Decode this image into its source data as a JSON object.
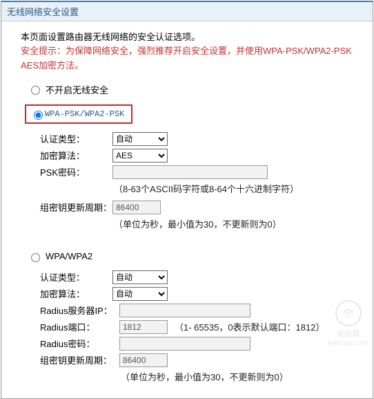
{
  "header": {
    "title": "无线网络安全设置"
  },
  "intro": "本页面设置路由器无线网络的安全认证选项。",
  "warning": "安全提示：为保障网络安全，强烈推荐开启安全设置，并使用WPA-PSK/WPA2-PSK AES加密方法。",
  "options": {
    "disable": {
      "label": "不开启无线安全",
      "selected": false
    },
    "wpa_psk": {
      "label": "WPA-PSK/WPA2-PSK",
      "selected": true
    },
    "wpa": {
      "label": "WPA/WPA2",
      "selected": false
    }
  },
  "psk": {
    "auth_label": "认证类型：",
    "auth_value": "自动",
    "algo_label": "加密算法：",
    "algo_value": "AES",
    "psk_label": "PSK密码：",
    "psk_value": "",
    "psk_hint": "（8-63个ASCII码字符或8-64个十六进制字符）",
    "rekey_label": "组密钥更新周期：",
    "rekey_value": "86400",
    "rekey_hint": "（单位为秒，最小值为30，不更新则为0）"
  },
  "wpa": {
    "auth_label": "认证类型：",
    "auth_value": "自动",
    "algo_label": "加密算法：",
    "algo_value": "自动",
    "radius_ip_label": "Radius服务器IP：",
    "radius_ip_value": "",
    "radius_port_label": "Radius端口：",
    "radius_port_value": "1812",
    "radius_port_hint": "（1- 65535，0表示默认端口：1812）",
    "radius_pw_label": "Radius密码：",
    "radius_pw_value": "",
    "rekey_label": "组密钥更新周期：",
    "rekey_value": "86400",
    "rekey_hint": "（单位为秒，最小值为30，不更新则为0）"
  },
  "watermark": {
    "brand": "路由器",
    "domain": "luyouqi.com"
  }
}
